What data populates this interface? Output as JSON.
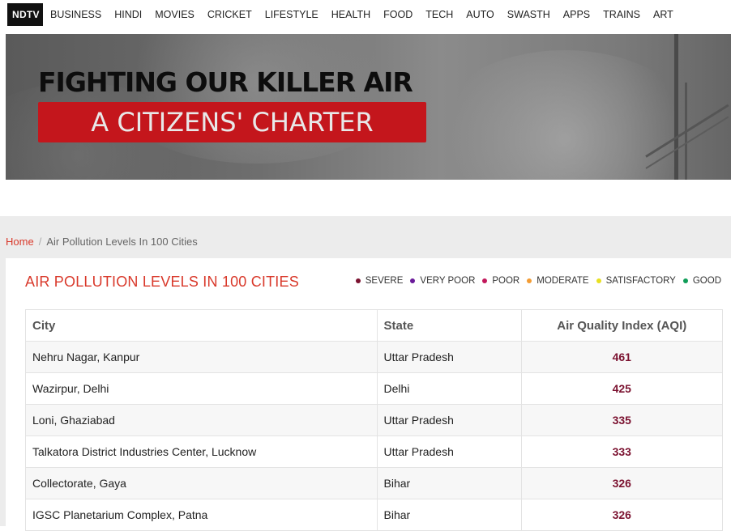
{
  "nav": {
    "logo": "NDTV",
    "links": [
      "BUSINESS",
      "HINDI",
      "MOVIES",
      "CRICKET",
      "LIFESTYLE",
      "HEALTH",
      "FOOD",
      "TECH",
      "AUTO",
      "SWASTH",
      "APPS",
      "TRAINS",
      "ART"
    ]
  },
  "banner": {
    "headline": "FIGHTING OUR KILLER AIR",
    "subheadline": "A CITIZENS' CHARTER",
    "accent": "#c4161c"
  },
  "breadcrumb": {
    "home": "Home",
    "separator": "/",
    "current": "Air Pollution Levels In 100 Cities"
  },
  "panel": {
    "title": "AIR POLLUTION LEVELS IN 100 CITIES"
  },
  "legend": [
    {
      "label": "SEVERE",
      "color": "#7b1230"
    },
    {
      "label": "VERY POOR",
      "color": "#6a1b9a"
    },
    {
      "label": "POOR",
      "color": "#c2185b"
    },
    {
      "label": "MODERATE",
      "color": "#f39c34"
    },
    {
      "label": "SATISFACTORY",
      "color": "#e8e021"
    },
    {
      "label": "GOOD",
      "color": "#0f9d58"
    }
  ],
  "table": {
    "headers": {
      "city": "City",
      "state": "State",
      "aqi": "Air Quality Index (AQI)"
    },
    "rows": [
      {
        "city": "Nehru Nagar, Kanpur",
        "state": "Uttar Pradesh",
        "aqi": "461"
      },
      {
        "city": "Wazirpur, Delhi",
        "state": "Delhi",
        "aqi": "425"
      },
      {
        "city": "Loni, Ghaziabad",
        "state": "Uttar Pradesh",
        "aqi": "335"
      },
      {
        "city": "Talkatora District Industries Center, Lucknow",
        "state": "Uttar Pradesh",
        "aqi": "333"
      },
      {
        "city": "Collectorate, Gaya",
        "state": "Bihar",
        "aqi": "326"
      },
      {
        "city": "IGSC Planetarium Complex, Patna",
        "state": "Bihar",
        "aqi": "326"
      }
    ]
  }
}
